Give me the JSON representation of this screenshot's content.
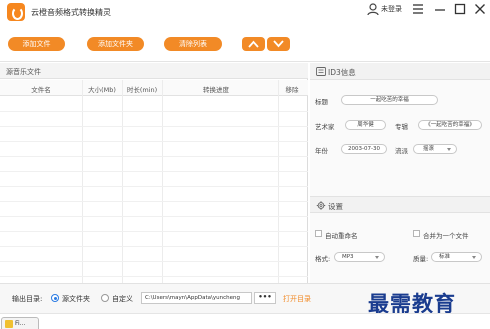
{
  "app": {
    "title": "云橙音频格式转换精灵",
    "login": "未登录"
  },
  "toolbar": {
    "add_file": "添加文件",
    "add_folder": "添加文件夹",
    "clear_list": "清除列表"
  },
  "file_list": {
    "header": "源音乐文件",
    "columns": [
      "文件名",
      "大小(Mb)",
      "时长(min)",
      "转换进度",
      "移除"
    ]
  },
  "id3": {
    "title": "ID3信息",
    "labels": {
      "title": "标题",
      "artist": "艺术家",
      "album": "专辑",
      "year": "年份",
      "genre": "流派"
    },
    "values": {
      "title": "一起吃苦的幸福",
      "artist": "周华健",
      "album": "《一起吃苦的幸福》",
      "year": "2003-07-30",
      "genre": "摇滚"
    }
  },
  "settings": {
    "title": "设置",
    "auto_rename": "自动重命名",
    "merge": "合并为一个文件",
    "format_label": "格式:",
    "format_value": "MP3",
    "quality_label": "质量:",
    "quality_value": "标准"
  },
  "output": {
    "label": "输出目录:",
    "opt_source": "源文件夹",
    "opt_custom": "自定义",
    "selected": "源文件夹",
    "path": "C:\\Users\\mayn\\AppData\\yuncheng",
    "browse": "•••",
    "open_dir": "打开目录"
  },
  "watermark": "最需教育",
  "taskbar": {
    "item": "Fi..."
  },
  "colors": {
    "accent": "#f28a26",
    "watermark": "#1a3c8f",
    "radio_on": "#2a7ae2"
  }
}
